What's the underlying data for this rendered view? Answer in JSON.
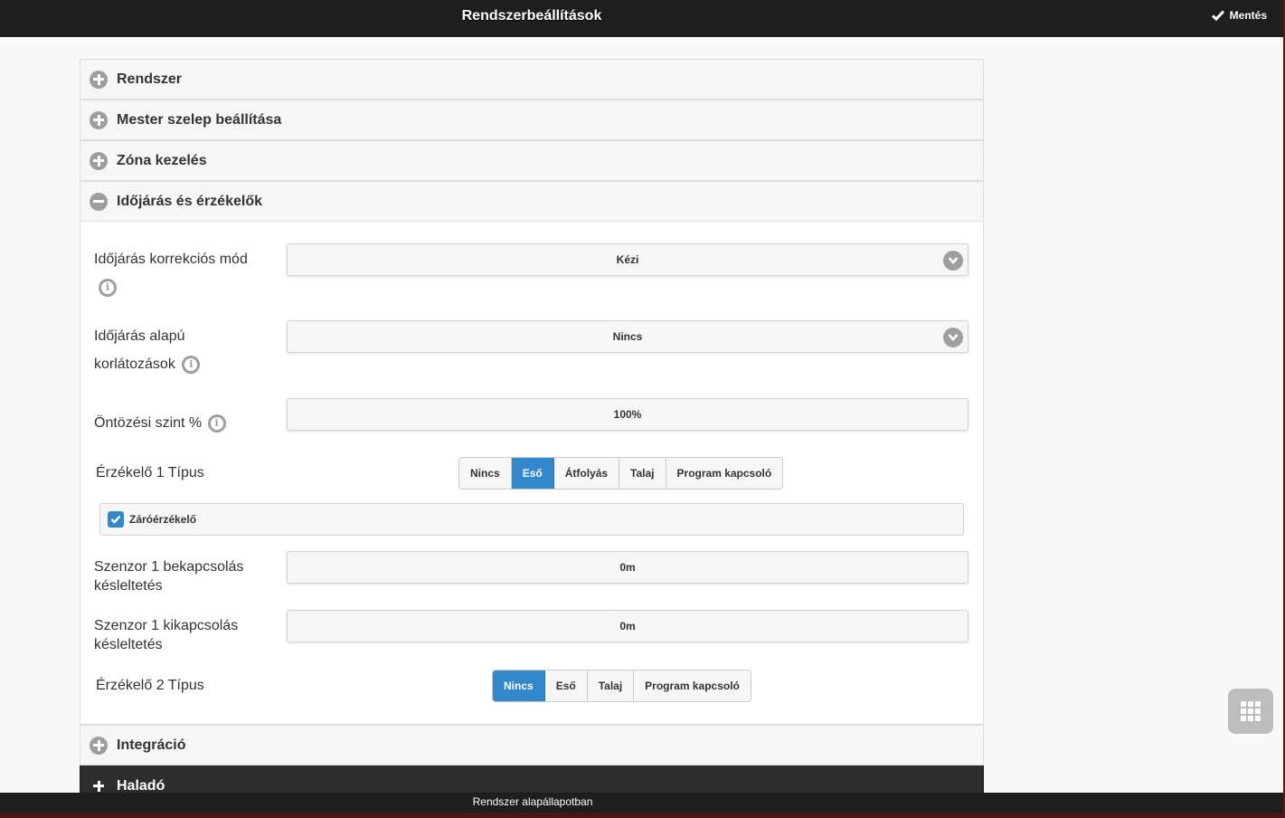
{
  "header": {
    "title": "Rendszerbeállítások",
    "save_label": "Mentés"
  },
  "sections": [
    {
      "label": "Rendszer",
      "expanded": false
    },
    {
      "label": "Mester szelep beállítása",
      "expanded": false
    },
    {
      "label": "Zóna kezelés",
      "expanded": false
    },
    {
      "label": "Időjárás és érzékelők",
      "expanded": true
    },
    {
      "label": "Integráció",
      "expanded": false
    },
    {
      "label": "Haladó",
      "expanded": false
    }
  ],
  "weather": {
    "correction_label": "Időjárás korrekciós mód",
    "correction_value": "Kézi",
    "restriction_label_1": "Időjárás alapú",
    "restriction_label_2": "korlátozások",
    "restriction_value": "Nincs",
    "level_label": "Öntözési szint %",
    "level_value": "100%",
    "sensor1_type_label": "Érzékelő 1 Típus",
    "sensor1_options": [
      "Nincs",
      "Eső",
      "Átfolyás",
      "Talaj",
      "Program kapcsoló"
    ],
    "sensor1_selected": "Eső",
    "closing_sensor_label": "Záróérzékelő",
    "closing_sensor_checked": true,
    "sensor1_on_delay_label_1": "Szenzor 1 bekapcsolás",
    "sensor1_on_delay_label_2": "késleltetés",
    "sensor1_on_delay_value": "0m",
    "sensor1_off_delay_label_1": "Szenzor 1 kikapcsolás",
    "sensor1_off_delay_label_2": "késleltetés",
    "sensor1_off_delay_value": "0m",
    "sensor2_type_label": "Érzékelő 2 Típus",
    "sensor2_options": [
      "Nincs",
      "Eső",
      "Talaj",
      "Program kapcsoló"
    ],
    "sensor2_selected": "Nincs",
    "info_glyph": "i"
  },
  "footer": {
    "status": "Rendszer alapállapotban"
  },
  "colors": {
    "accent": "#3388cc",
    "header_bg": "#1e1e1e",
    "icon_gray": "#9e9e9e"
  },
  "icons": {
    "save": "check-icon",
    "expand": "plus-circle-icon",
    "collapse": "minus-circle-icon",
    "menu": "grid-icon",
    "select": "chevron-down-icon",
    "info": "info-icon"
  }
}
